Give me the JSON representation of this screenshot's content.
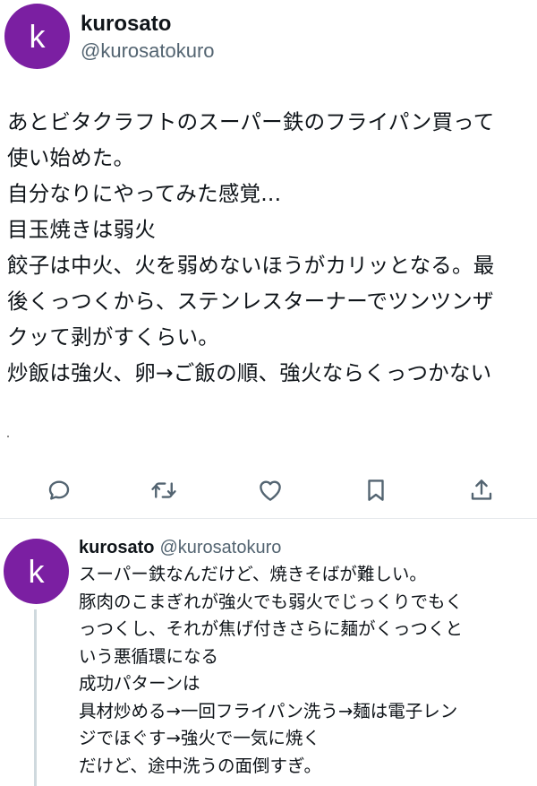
{
  "main_tweet": {
    "avatar_letter": "k",
    "display_name": "kurosato",
    "handle": "@kurosatokuro",
    "lines": [
      "あとビタクラフトのスーパー鉄のフライパン買って",
      "使い始めた。",
      "自分なりにやってみた感覚...",
      "目玉焼きは弱火",
      "餃子は中火、火を弱めないほうがカリッとなる。最",
      "後くっつくから、ステンレスターナーでツンツンザ",
      "クッて剥がすくらい。",
      "炒飯は強火、卵→ご飯の順、強火ならくっつかない"
    ],
    "actions": [
      "reply-icon",
      "retweet-icon",
      "like-icon",
      "bookmark-icon",
      "share-icon"
    ]
  },
  "reply_tweet": {
    "avatar_letter": "k",
    "display_name": "kurosato",
    "handle": "@kurosatokuro",
    "lines": [
      "スーパー鉄なんだけど、焼きそばが難しい。",
      "豚肉のこまぎれが強火でも弱火でじっくりでもく",
      "っつくし、それが焦げ付きさらに麺がくっつくと",
      "いう悪循環になる",
      "成功パターンは",
      "具材炒める→一回フライパン洗う→麺は電子レン",
      "ジでほぐす→強火で一気に焼く",
      "だけど、途中洗うの面倒すぎ。"
    ]
  },
  "colors": {
    "avatar_bg": "#7b1fa2",
    "text": "#0f1419",
    "secondary_text": "#536471",
    "icon": "#536471",
    "thread_line": "#cfd9de"
  }
}
